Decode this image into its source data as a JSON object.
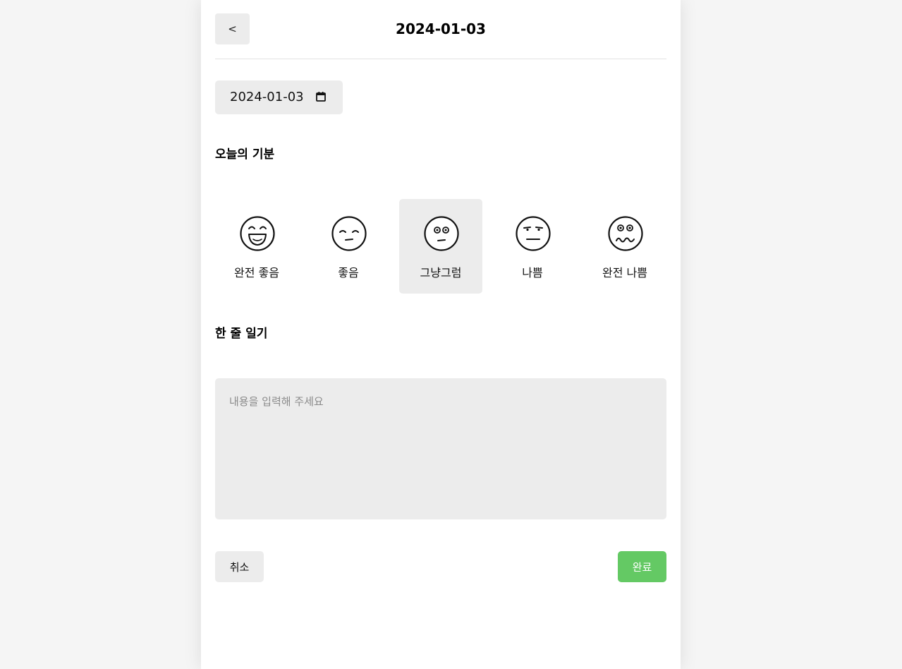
{
  "header": {
    "back_label": "<",
    "title": "2024-01-03"
  },
  "date_input": {
    "value": "2024-01-03",
    "icon": "calendar-icon"
  },
  "emotion_section": {
    "title": "오늘의 기분",
    "selected_index": 2,
    "items": [
      {
        "label": "완전 좋음",
        "icon": "very-happy-face-icon"
      },
      {
        "label": "좋음",
        "icon": "content-face-icon"
      },
      {
        "label": "그냥그럼",
        "icon": "neutral-face-icon"
      },
      {
        "label": "나쁨",
        "icon": "annoyed-face-icon"
      },
      {
        "label": "완전 나쁨",
        "icon": "distressed-face-icon"
      }
    ]
  },
  "diary_section": {
    "title": "한 줄 일기",
    "value": "",
    "placeholder": "내용을 입력해 주세요"
  },
  "footer": {
    "cancel_label": "취소",
    "submit_label": "완료"
  },
  "colors": {
    "page_background": "#f5f5f5",
    "card_background": "#ffffff",
    "control_background": "#ececec",
    "submit_background": "#64c964",
    "submit_text": "#ffffff"
  }
}
